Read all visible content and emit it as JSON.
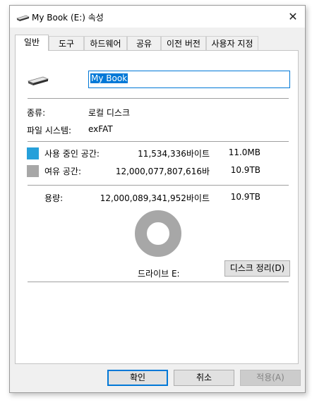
{
  "window": {
    "title": "My Book (E:) 속성",
    "close_glyph": "✕"
  },
  "tabs": [
    {
      "label": "일반",
      "active": true
    },
    {
      "label": "도구"
    },
    {
      "label": "하드웨어"
    },
    {
      "label": "공유"
    },
    {
      "label": "이전 버전"
    },
    {
      "label": "사용자 지정"
    }
  ],
  "general": {
    "drive_name": "My Book",
    "type_label": "종류:",
    "type_value": "로컬 디스크",
    "fs_label": "파일 시스템:",
    "fs_value": "exFAT",
    "used": {
      "label": "사용 중인 공간:",
      "bytes": "11,534,336바이트",
      "size": "11.0MB",
      "color": "#26a0da"
    },
    "free": {
      "label": "여유 공간:",
      "bytes": "12,000,077,807,616바",
      "size": "10.9TB",
      "color": "#a7a7a7"
    },
    "capacity": {
      "label": "용량:",
      "bytes": "12,000,089,341,952바이트",
      "size": "10.9TB"
    },
    "drive_label": "드라이브 E:",
    "cleanup_button": "디스크 정리(D)",
    "used_fraction": 9.6e-07
  },
  "buttons": {
    "ok": "확인",
    "cancel": "취소",
    "apply": "적용(A)"
  }
}
